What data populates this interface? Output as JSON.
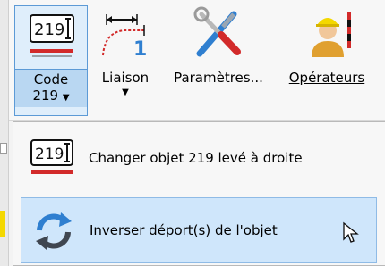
{
  "ribbon": {
    "code": {
      "label": "Code",
      "value": "219",
      "icon_text": "219"
    },
    "liaison": {
      "label": "Liaison"
    },
    "params": {
      "label": "Paramètres..."
    },
    "operators": {
      "label": "Opérateurs"
    }
  },
  "menu": {
    "items": [
      {
        "label": "Changer objet 219  levé à droite",
        "icon": "code-219-icon",
        "icon_text": "219"
      },
      {
        "label": "Inverser déport(s) de l'objet",
        "icon": "swap-arrows-icon"
      }
    ]
  },
  "colors": {
    "accent": "#5c9ad6",
    "highlight": "#cfe6fb",
    "pressed": "#b9d7f2",
    "red": "#d22a2a",
    "blue": "#2f7fd0"
  }
}
